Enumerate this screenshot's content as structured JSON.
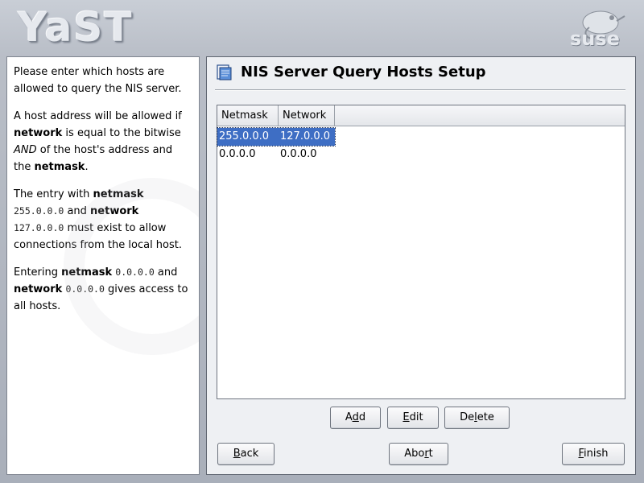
{
  "banner": {
    "product_logo": "YaST",
    "vendor_logo": "suse"
  },
  "help": {
    "p1": "Please enter which hosts are allowed to query the NIS server.",
    "p2_a": "A host address will be allowed if ",
    "p2_b": "network",
    "p2_c": " is equal to the bitwise ",
    "p2_d": "AND",
    "p2_e": " of the host's address and the ",
    "p2_f": "netmask",
    "p2_g": ".",
    "p3_a": "The entry with ",
    "p3_b": "netmask",
    "p3_c": "255.0.0.0",
    "p3_d": " and ",
    "p3_e": "network",
    "p3_f": "127.0.0.0",
    "p3_g": " must exist to allow connections from the local host.",
    "p4_a": "Entering ",
    "p4_b": "netmask",
    "p4_c": "0.0.0.0",
    "p4_d": " and ",
    "p4_e": "network",
    "p4_f": "0.0.0.0",
    "p4_g": " gives access to all hosts."
  },
  "dialog": {
    "title": "NIS Server Query Hosts Setup",
    "icon": "document-icon"
  },
  "table": {
    "columns": [
      "Netmask",
      "Network"
    ],
    "rows": [
      [
        "255.0.0.0",
        "127.0.0.0"
      ],
      [
        "0.0.0.0",
        "0.0.0.0"
      ]
    ],
    "selected_row": 0
  },
  "buttons": {
    "add": {
      "pre": "A",
      "key": "d",
      "post": "d"
    },
    "edit": {
      "pre": "",
      "key": "E",
      "post": "dit"
    },
    "delete": {
      "pre": "De",
      "key": "l",
      "post": "ete"
    },
    "back": {
      "pre": "",
      "key": "B",
      "post": "ack"
    },
    "abort": {
      "pre": "Abo",
      "key": "r",
      "post": "t"
    },
    "finish": {
      "pre": "",
      "key": "F",
      "post": "inish"
    }
  },
  "colors": {
    "selection": "#3e6ec4",
    "panel_background": "#eef0f3"
  }
}
